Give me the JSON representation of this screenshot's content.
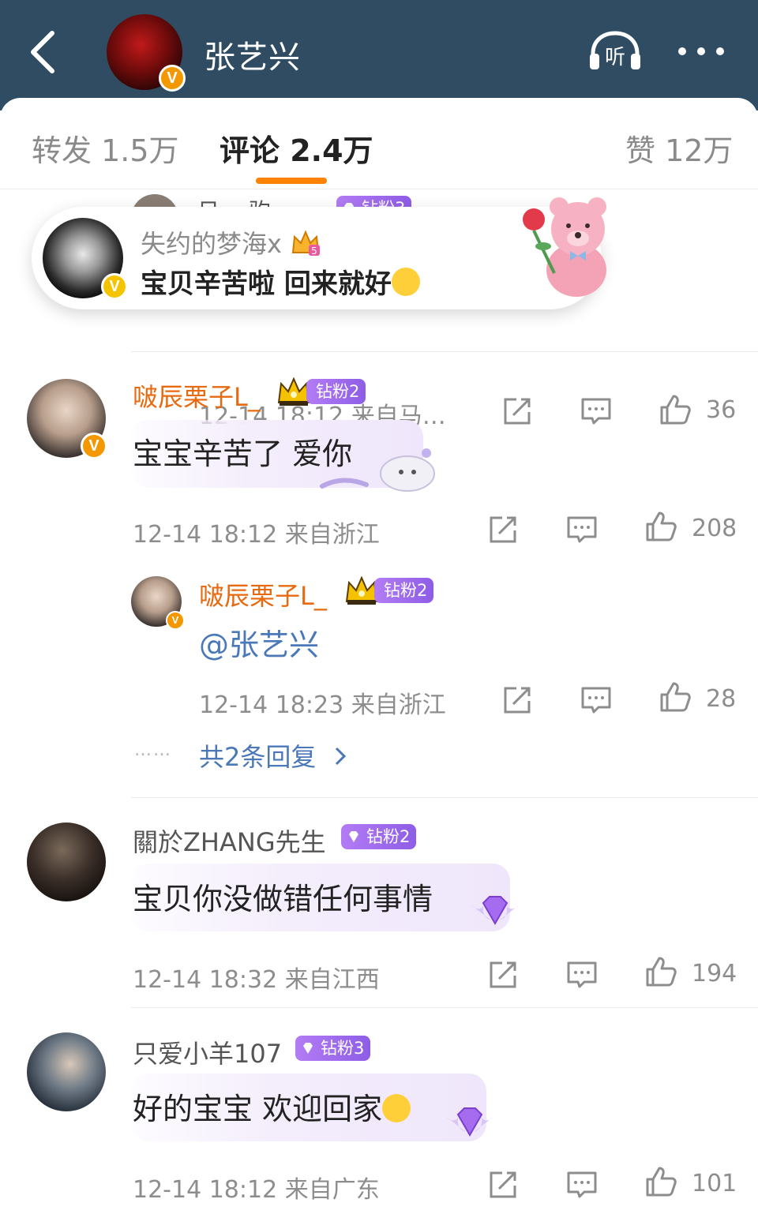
{
  "header": {
    "username": "张艺兴",
    "listen_label": "听"
  },
  "tabs": [
    {
      "label": "转发 1.5万"
    },
    {
      "label": "评论 2.4万"
    },
    {
      "label": "赞 12万"
    }
  ],
  "toast": {
    "name": "失约的梦海x",
    "level": "5",
    "text": "宝贝辛苦啦 回来就好"
  },
  "partial_comment": {
    "name_fragment": "日… 驹",
    "badge": "钻粉3",
    "meta": "12-14 18:12 来自马…",
    "likes": "36"
  },
  "comments": [
    {
      "name": "啵辰栗子L_",
      "badge": "钻粉2",
      "text": "宝宝辛苦了 爱你",
      "meta": "12-14 18:12 来自浙江",
      "likes": "208",
      "reply": {
        "name": "啵辰栗子L_",
        "badge": "钻粉2",
        "text": "@张艺兴",
        "meta": "12-14 18:23 来自浙江",
        "likes": "28"
      },
      "more_replies": "共2条回复",
      "dots": "……"
    },
    {
      "name": "關於ZHANG先生",
      "badge": "钻粉2",
      "text": "宝贝你没做错任何事情",
      "meta": "12-14 18:32 来自江西",
      "likes": "194"
    },
    {
      "name": "只爱小羊107",
      "badge": "钻粉3",
      "text": "好的宝宝 欢迎回家",
      "meta": "12-14 18:12 来自广东",
      "likes": "101"
    }
  ],
  "colors": {
    "header_bg": "#2f4c62",
    "accent": "#ff8200",
    "vip_name": "#e86a10",
    "link": "#4a78b8",
    "badge": "#9b6bea"
  }
}
